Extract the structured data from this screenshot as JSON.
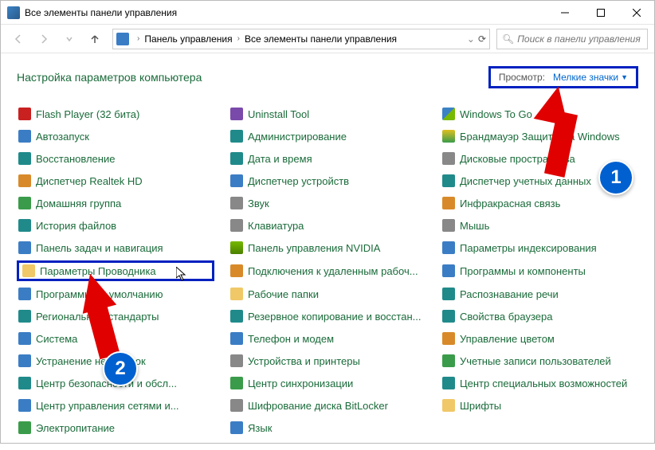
{
  "window": {
    "title": "Все элементы панели управления"
  },
  "breadcrumb": {
    "part1": "Панель управления",
    "part2": "Все элементы панели управления"
  },
  "search": {
    "placeholder": "Поиск в панели управления"
  },
  "heading": "Настройка параметров компьютера",
  "view": {
    "label": "Просмотр:",
    "value": "Мелкие значки"
  },
  "annotations": {
    "badge1": "1",
    "badge2": "2"
  },
  "items": {
    "col1": [
      {
        "label": "Flash Player (32 бита)",
        "ic": "ic-red"
      },
      {
        "label": "Автозапуск",
        "ic": "ic-blue"
      },
      {
        "label": "Восстановление",
        "ic": "ic-teal"
      },
      {
        "label": "Диспетчер Realtek HD",
        "ic": "ic-orange"
      },
      {
        "label": "Домашняя группа",
        "ic": "ic-green"
      },
      {
        "label": "История файлов",
        "ic": "ic-teal"
      },
      {
        "label": "Панель задач и навигация",
        "ic": "ic-blue"
      },
      {
        "label": "Параметры Проводника",
        "ic": "ic-folder",
        "highlighted": true
      },
      {
        "label": "Программы по умолчанию",
        "ic": "ic-blue"
      },
      {
        "label": "Региональные стандарты",
        "ic": "ic-teal"
      },
      {
        "label": "Система",
        "ic": "ic-blue"
      },
      {
        "label": "Устранение неполадок",
        "ic": "ic-blue"
      },
      {
        "label": "Центр безопасности и обсл...",
        "ic": "ic-teal"
      },
      {
        "label": "Центр управления сетями и...",
        "ic": "ic-blue"
      },
      {
        "label": "Электропитание",
        "ic": "ic-green"
      }
    ],
    "col2": [
      {
        "label": "Uninstall Tool",
        "ic": "ic-purple"
      },
      {
        "label": "Администрирование",
        "ic": "ic-teal"
      },
      {
        "label": "Дата и время",
        "ic": "ic-teal"
      },
      {
        "label": "Диспетчер устройств",
        "ic": "ic-blue"
      },
      {
        "label": "Звук",
        "ic": "ic-gray"
      },
      {
        "label": "Клавиатура",
        "ic": "ic-gray"
      },
      {
        "label": "Панель управления NVIDIA",
        "ic": "ic-nvidia"
      },
      {
        "label": "Подключения к удаленным рабоч...",
        "ic": "ic-orange"
      },
      {
        "label": "Рабочие папки",
        "ic": "ic-folder"
      },
      {
        "label": "Резервное копирование и восстан...",
        "ic": "ic-teal"
      },
      {
        "label": "Телефон и модем",
        "ic": "ic-blue"
      },
      {
        "label": "Устройства и принтеры",
        "ic": "ic-gray"
      },
      {
        "label": "Центр синхронизации",
        "ic": "ic-green"
      },
      {
        "label": "Шифрование диска BitLocker",
        "ic": "ic-gray"
      },
      {
        "label": "Язык",
        "ic": "ic-blue"
      }
    ],
    "col3": [
      {
        "label": "Windows To Go",
        "ic": "ic-windows"
      },
      {
        "label": "Брандмауэр Защитника Windows",
        "ic": "ic-shield"
      },
      {
        "label": "Дисковые пространства",
        "ic": "ic-gray"
      },
      {
        "label": "Диспетчер учетных данных",
        "ic": "ic-teal"
      },
      {
        "label": "Инфракрасная связь",
        "ic": "ic-orange"
      },
      {
        "label": "Мышь",
        "ic": "ic-gray"
      },
      {
        "label": "Параметры индексирования",
        "ic": "ic-blue"
      },
      {
        "label": "Программы и компоненты",
        "ic": "ic-blue"
      },
      {
        "label": "Распознавание речи",
        "ic": "ic-teal"
      },
      {
        "label": "Свойства браузера",
        "ic": "ic-teal"
      },
      {
        "label": "Управление цветом",
        "ic": "ic-orange"
      },
      {
        "label": "Учетные записи пользователей",
        "ic": "ic-green"
      },
      {
        "label": "Центр специальных возможностей",
        "ic": "ic-teal"
      },
      {
        "label": "Шрифты",
        "ic": "ic-folder"
      }
    ]
  }
}
